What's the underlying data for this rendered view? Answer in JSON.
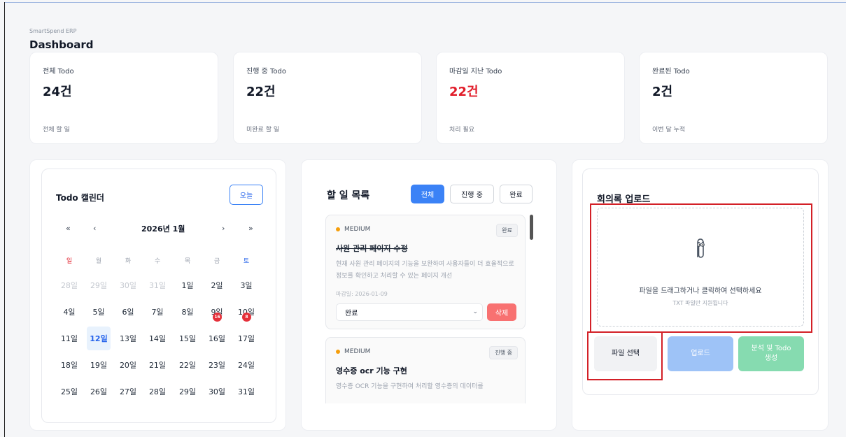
{
  "header": {
    "brand": "SmartSpend ERP",
    "title": "Dashboard"
  },
  "stats": [
    {
      "label": "전체 Todo",
      "value": "24건",
      "sub": "전체 할 일"
    },
    {
      "label": "진행 중 Todo",
      "value": "22건",
      "sub": "미완료 할 일"
    },
    {
      "label": "마감일 지난 Todo",
      "value": "22건",
      "sub": "처리 필요",
      "value_color": "#e11d2a"
    },
    {
      "label": "완료된 Todo",
      "value": "2건",
      "sub": "이번 달 누적"
    }
  ],
  "calendar": {
    "title": "Todo 캘린더",
    "today_label": "오늘",
    "nav": {
      "prev_year": "«",
      "prev_month": "‹",
      "next_month": "›",
      "next_year": "»"
    },
    "month_label": "2026년 1월",
    "weekdays": [
      "일",
      "월",
      "화",
      "수",
      "목",
      "금",
      "토"
    ],
    "weeks": [
      [
        "28일",
        "29일",
        "30일",
        "31일",
        "1일",
        "2일",
        "3일"
      ],
      [
        "4일",
        "5일",
        "6일",
        "7일",
        "8일",
        "9일",
        "10일"
      ],
      [
        "11일",
        "12일",
        "13일",
        "14일",
        "15일",
        "16일",
        "17일"
      ],
      [
        "18일",
        "19일",
        "20일",
        "21일",
        "22일",
        "23일",
        "24일"
      ],
      [
        "25일",
        "26일",
        "27일",
        "28일",
        "29일",
        "30일",
        "31일"
      ]
    ],
    "selected_day": "12일",
    "badges": {
      "9일": "16",
      "10일": "8"
    }
  },
  "todo": {
    "title": "할 일 목록",
    "filters": [
      "전체",
      "진행 중",
      "완료"
    ],
    "active_filter": "전체",
    "items": [
      {
        "priority": "MEDIUM",
        "status": "완료",
        "title": "사원 관리 페이지 수정",
        "description": "현재 사원 관리 페이지의 기능을 보완하여 사용자들이 더 효율적으로 정보를 확인하고 처리할 수 있는 페이지 개선",
        "due": "마감일: 2026-01-09",
        "select_value": "완료",
        "delete_label": "삭제"
      },
      {
        "priority": "MEDIUM",
        "status": "진행 중",
        "title": "영수증 ocr 기능 구현",
        "description": "영수증 OCR 기능을 구현하여 처리할 영수증의 데이터를"
      }
    ]
  },
  "upload": {
    "title": "회의록 업로드",
    "icon": "paperclip-icon",
    "drop_text": "파일을 드래그하거나 클릭하여 선택하세요",
    "drop_sub": "TXT 파일만 지원됩니다",
    "buttons": {
      "select": "파일 선택",
      "upload": "업로드",
      "analyze": "분석 및 Todo 생성"
    }
  },
  "colors": {
    "accent": "#3b82f6",
    "danger": "#e11d2a",
    "analyze_btn": "#86dbb0",
    "upload_btn": "#9ec3f7",
    "highlight": "#d32027"
  }
}
